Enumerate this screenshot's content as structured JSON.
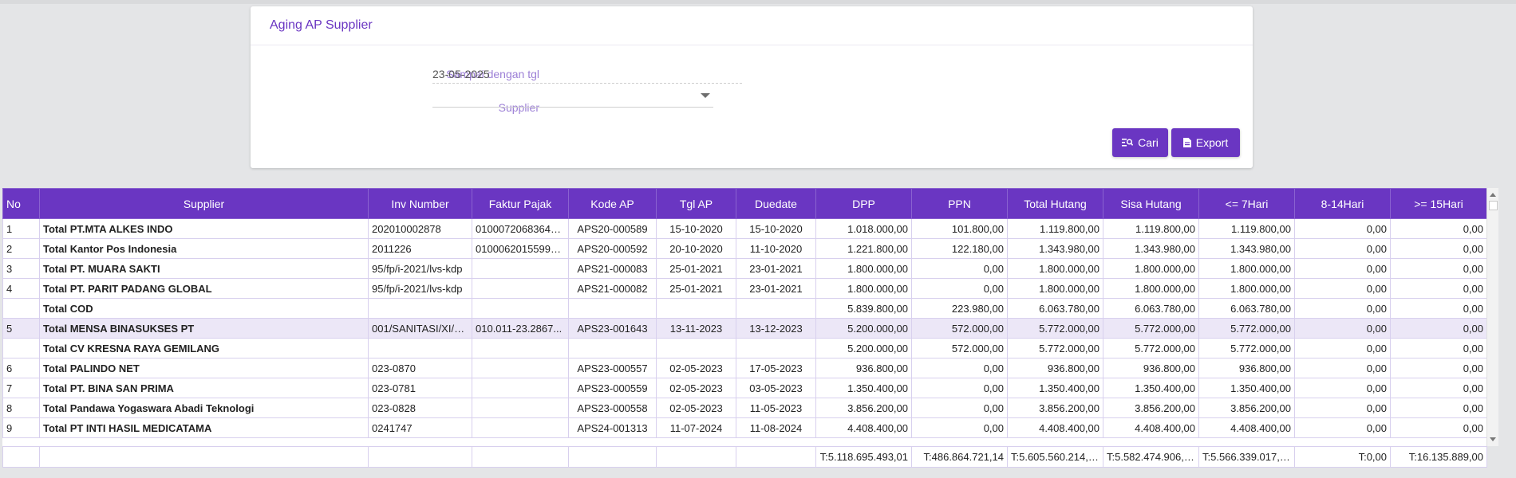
{
  "card": {
    "title": "Aging AP Supplier",
    "date_label": "Sampai dengan tgl",
    "date_value": "23-05-2025",
    "supplier_label": "Supplier",
    "supplier_value": "",
    "search_label": "Cari",
    "export_label": "Export",
    "search_icon": "search-list-icon",
    "export_icon": "document-icon"
  },
  "colors": {
    "primary": "#6a36c2",
    "label": "#9c7fd6",
    "highlight_row": "#ece7f7"
  },
  "table": {
    "headers": [
      "No",
      "Supplier",
      "Inv Number",
      "Faktur Pajak",
      "Kode AP",
      "Tgl AP",
      "Duedate",
      "DPP",
      "PPN",
      "Total Hutang",
      "Sisa Hutang",
      "<= 7Hari",
      "8-14Hari",
      ">= 15Hari"
    ],
    "rows": [
      {
        "no": "1",
        "supplier": "Total PT.MTA ALKES INDO",
        "inv": "202010002878",
        "faktur": "01000720683645...",
        "kode": "APS20-000589",
        "tgl": "15-10-2020",
        "due": "15-10-2020",
        "dpp": "1.018.000,00",
        "ppn": "101.800,00",
        "total": "1.119.800,00",
        "sisa": "1.119.800,00",
        "d7": "1.119.800,00",
        "d14": "0,00",
        "d15": "0,00"
      },
      {
        "no": "2",
        "supplier": "Total Kantor Pos Indonesia",
        "inv": "2011226",
        "faktur": "01000620155992...",
        "kode": "APS20-000592",
        "tgl": "20-10-2020",
        "due": "11-10-2020",
        "dpp": "1.221.800,00",
        "ppn": "122.180,00",
        "total": "1.343.980,00",
        "sisa": "1.343.980,00",
        "d7": "1.343.980,00",
        "d14": "0,00",
        "d15": "0,00"
      },
      {
        "no": "3",
        "supplier": "Total PT. MUARA SAKTI",
        "inv": "95/fp/i-2021/lvs-kdp",
        "faktur": "",
        "kode": "APS21-000083",
        "tgl": "25-01-2021",
        "due": "23-01-2021",
        "dpp": "1.800.000,00",
        "ppn": "0,00",
        "total": "1.800.000,00",
        "sisa": "1.800.000,00",
        "d7": "1.800.000,00",
        "d14": "0,00",
        "d15": "0,00"
      },
      {
        "no": "4",
        "supplier": "Total PT. PARIT PADANG GLOBAL",
        "inv": "95/fp/i-2021/lvs-kdp",
        "faktur": "",
        "kode": "APS21-000082",
        "tgl": "25-01-2021",
        "due": "23-01-2021",
        "dpp": "1.800.000,00",
        "ppn": "0,00",
        "total": "1.800.000,00",
        "sisa": "1.800.000,00",
        "d7": "1.800.000,00",
        "d14": "0,00",
        "d15": "0,00"
      },
      {
        "no": "",
        "supplier": "Total COD",
        "inv": "",
        "faktur": "",
        "kode": "",
        "tgl": "",
        "due": "",
        "dpp": "5.839.800,00",
        "ppn": "223.980,00",
        "total": "6.063.780,00",
        "sisa": "6.063.780,00",
        "d7": "6.063.780,00",
        "d14": "0,00",
        "d15": "0,00"
      },
      {
        "no": "5",
        "supplier": "Total MENSA BINASUKSES PT",
        "inv": "001/SANITASI/XI/2...",
        "faktur": "010.011-23.2867...",
        "kode": "APS23-001643",
        "tgl": "13-11-2023",
        "due": "13-12-2023",
        "dpp": "5.200.000,00",
        "ppn": "572.000,00",
        "total": "5.772.000,00",
        "sisa": "5.772.000,00",
        "d7": "5.772.000,00",
        "d14": "0,00",
        "d15": "0,00",
        "highlight": true
      },
      {
        "no": "",
        "supplier": "Total CV KRESNA RAYA GEMILANG",
        "inv": "",
        "faktur": "",
        "kode": "",
        "tgl": "",
        "due": "",
        "dpp": "5.200.000,00",
        "ppn": "572.000,00",
        "total": "5.772.000,00",
        "sisa": "5.772.000,00",
        "d7": "5.772.000,00",
        "d14": "0,00",
        "d15": "0,00"
      },
      {
        "no": "6",
        "supplier": "Total PALINDO NET",
        "inv": "023-0870",
        "faktur": "",
        "kode": "APS23-000557",
        "tgl": "02-05-2023",
        "due": "17-05-2023",
        "dpp": "936.800,00",
        "ppn": "0,00",
        "total": "936.800,00",
        "sisa": "936.800,00",
        "d7": "936.800,00",
        "d14": "0,00",
        "d15": "0,00"
      },
      {
        "no": "7",
        "supplier": "Total PT. BINA SAN PRIMA",
        "inv": "023-0781",
        "faktur": "",
        "kode": "APS23-000559",
        "tgl": "02-05-2023",
        "due": "03-05-2023",
        "dpp": "1.350.400,00",
        "ppn": "0,00",
        "total": "1.350.400,00",
        "sisa": "1.350.400,00",
        "d7": "1.350.400,00",
        "d14": "0,00",
        "d15": "0,00"
      },
      {
        "no": "8",
        "supplier": "Total Pandawa Yogaswara Abadi Teknologi",
        "inv": "023-0828",
        "faktur": "",
        "kode": "APS23-000558",
        "tgl": "02-05-2023",
        "due": "11-05-2023",
        "dpp": "3.856.200,00",
        "ppn": "0,00",
        "total": "3.856.200,00",
        "sisa": "3.856.200,00",
        "d7": "3.856.200,00",
        "d14": "0,00",
        "d15": "0,00"
      },
      {
        "no": "9",
        "supplier": "Total PT INTI HASIL MEDICATAMA",
        "inv": "0241747",
        "faktur": "",
        "kode": "APS24-001313",
        "tgl": "11-07-2024",
        "due": "11-08-2024",
        "dpp": "4.408.400,00",
        "ppn": "0,00",
        "total": "4.408.400,00",
        "sisa": "4.408.400,00",
        "d7": "4.408.400,00",
        "d14": "0,00",
        "d15": "0,00"
      }
    ],
    "totals": {
      "dpp": "T:5.118.695.493,01",
      "ppn": "T:486.864.721,14",
      "total": "T:5.605.560.214,15",
      "sisa": "T:5.582.474.906,50",
      "d7": "T:5.566.339.017,50",
      "d14": "T:0,00",
      "d15": "T:16.135.889,00"
    }
  }
}
